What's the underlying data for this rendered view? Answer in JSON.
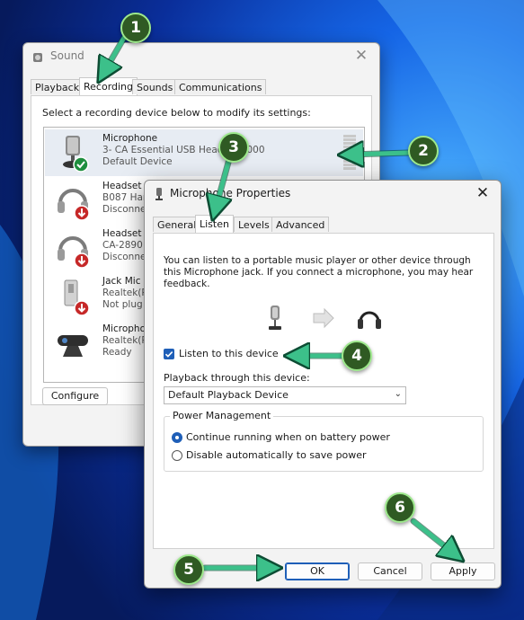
{
  "sound_window": {
    "title": "Sound",
    "close": "✕",
    "tabs": [
      "Playback",
      "Recording",
      "Sounds",
      "Communications"
    ],
    "active_tab": "Recording",
    "instructions": "Select a recording device below to modify its settings:",
    "devices": [
      {
        "name": "Microphone",
        "line2": "3- CA Essential USB Headset 2000",
        "line3": "Default Device",
        "status": "default",
        "selected": true
      },
      {
        "name": "Headset",
        "line2": "B087 Han",
        "line3": "Disconne",
        "status": "disconnected"
      },
      {
        "name": "Headset",
        "line2": "CA-2890 E",
        "line3": "Disconne",
        "status": "disconnected"
      },
      {
        "name": "Jack Mic",
        "line2": "Realtek(R",
        "line3": "Not plug",
        "status": "unplugged"
      },
      {
        "name": "Micropho",
        "line2": "Realtek(R",
        "line3": "Ready",
        "status": "ready"
      }
    ],
    "configure_label": "Configure"
  },
  "props_window": {
    "title": "Microphone Properties",
    "close": "✕",
    "tabs": [
      "General",
      "Listen",
      "Levels",
      "Advanced"
    ],
    "active_tab": "Listen",
    "description": "You can listen to a portable music player or other device through this Microphone jack.  If you connect a microphone, you may hear feedback.",
    "listen_checkbox_label": "Listen to this device",
    "listen_checked": true,
    "playback_label": "Playback through this device:",
    "playback_value": "Default Playback Device",
    "power_group_title": "Power Management",
    "power_options": [
      "Continue running when on battery power",
      "Disable automatically to save power"
    ],
    "power_selected": 0,
    "buttons": {
      "ok": "OK",
      "cancel": "Cancel",
      "apply": "Apply"
    }
  },
  "annotations": [
    "1",
    "2",
    "3",
    "4",
    "5",
    "6"
  ],
  "colors": {
    "badge_fill": "#2f5a23",
    "badge_ring": "#9de88c",
    "arrow": "#3cc08a",
    "accent": "#1f5fb8"
  }
}
